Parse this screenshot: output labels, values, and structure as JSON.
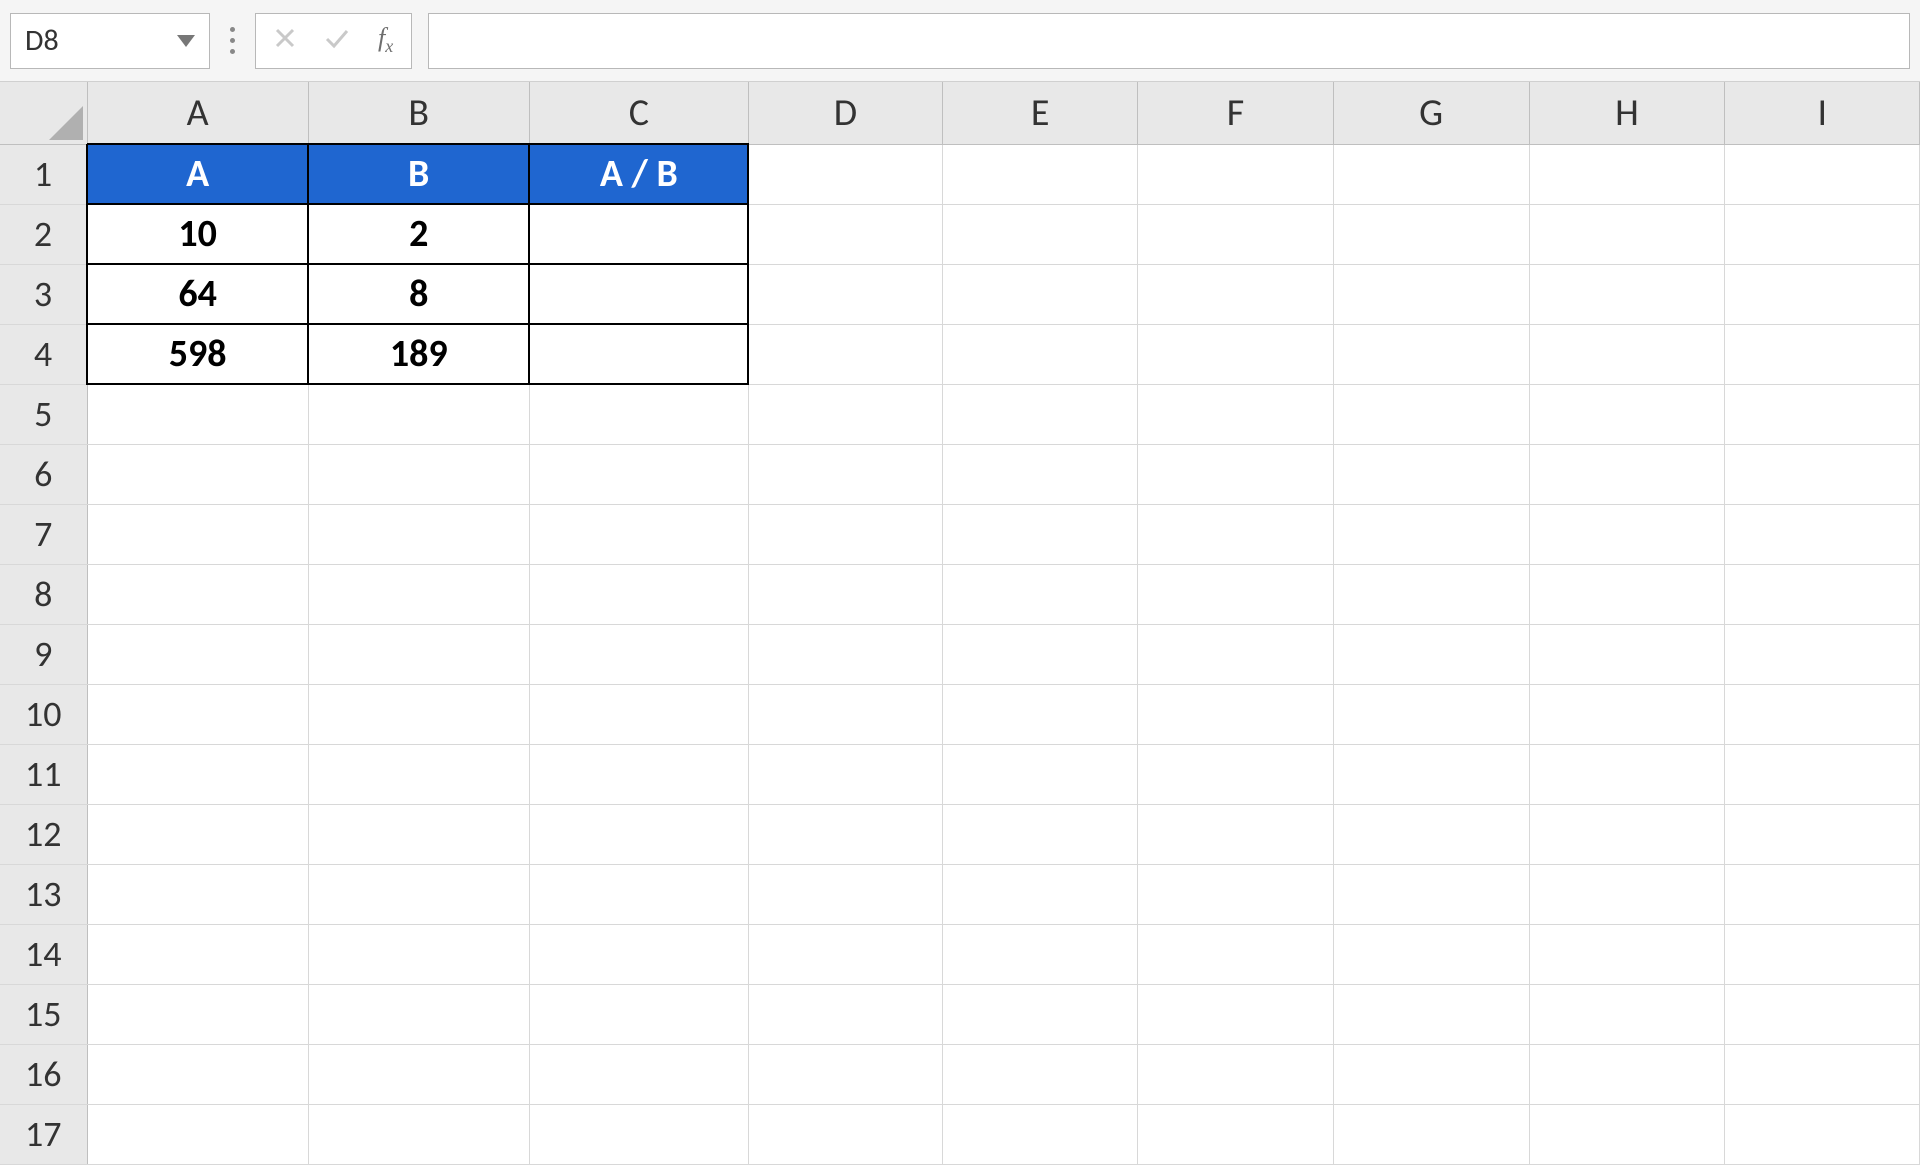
{
  "name_box": {
    "value": "D8"
  },
  "fx_label": "fx",
  "formula_bar": {
    "value": ""
  },
  "columns": [
    "A",
    "B",
    "C",
    "D",
    "E",
    "F",
    "G",
    "H",
    "I"
  ],
  "row_count": 17,
  "table": {
    "headers": [
      "A",
      "B",
      "A / B"
    ],
    "rows": [
      {
        "a": "10",
        "b": "2",
        "c": ""
      },
      {
        "a": "64",
        "b": "8",
        "c": ""
      },
      {
        "a": "598",
        "b": "189",
        "c": ""
      }
    ]
  },
  "colors": {
    "header_bg": "#1F66D0"
  }
}
